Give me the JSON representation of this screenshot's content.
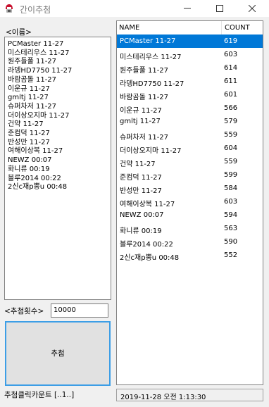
{
  "window": {
    "title": "간이추첨"
  },
  "left_panel": {
    "names_label": "<이름>",
    "names": [
      "PCMaster 11-27",
      "미스테리우스 11-27",
      "원주들풀 11-27",
      "라뎅HD7750 11-27",
      "바람곰돌 11-27",
      "이운규 11-27",
      "gmltj 11-27",
      "슈퍼차저 11-27",
      "더이상오지마 11-27",
      "건약 11-27",
      "준컴덕 11-27",
      "반성만 11-27",
      "여해이상복 11-27",
      "NEWZ 00:07",
      "화니류 00:19",
      "블루2014 00:22",
      "2신c재p뿡u 00:48"
    ],
    "count_label": "<추첨횟수>",
    "count_value": "10000",
    "draw_button": "추첨",
    "click_counter": "추첨클릭카운트 [..1..]"
  },
  "table": {
    "headers": {
      "name": "NAME",
      "count": "COUNT"
    },
    "rows": [
      {
        "name": "PCMaster 11-27",
        "count": "619",
        "selected": true
      },
      {
        "name": "미스테리우스 11-27",
        "count": "603"
      },
      {
        "name": "원주들풀 11-27",
        "count": "614"
      },
      {
        "name": "라뎅HD7750 11-27",
        "count": "611"
      },
      {
        "name": "바람곰돌 11-27",
        "count": "601"
      },
      {
        "name": "이운규 11-27",
        "count": "566"
      },
      {
        "name": "gmltj 11-27",
        "count": "579"
      },
      {
        "name": "슈퍼차저 11-27",
        "count": "559"
      },
      {
        "name": "더이상오지마 11-27",
        "count": "604"
      },
      {
        "name": "건약 11-27",
        "count": "559"
      },
      {
        "name": "준컴덕 11-27",
        "count": "599"
      },
      {
        "name": "반성만 11-27",
        "count": "584"
      },
      {
        "name": "여해이상복 11-27",
        "count": "603"
      },
      {
        "name": "NEWZ 00:07",
        "count": "594"
      },
      {
        "name": "화니류 00:19",
        "count": "563"
      },
      {
        "name": "블루2014 00:22",
        "count": "590"
      },
      {
        "name": "2신c재p뿡u 00:48",
        "count": "552"
      }
    ]
  },
  "status": {
    "datetime": "2019-11-28 오전 1:13:30"
  },
  "colors": {
    "selection": "#0078d7",
    "button_focus_border": "#3c9ee6",
    "app_icon": "#c8102e"
  }
}
